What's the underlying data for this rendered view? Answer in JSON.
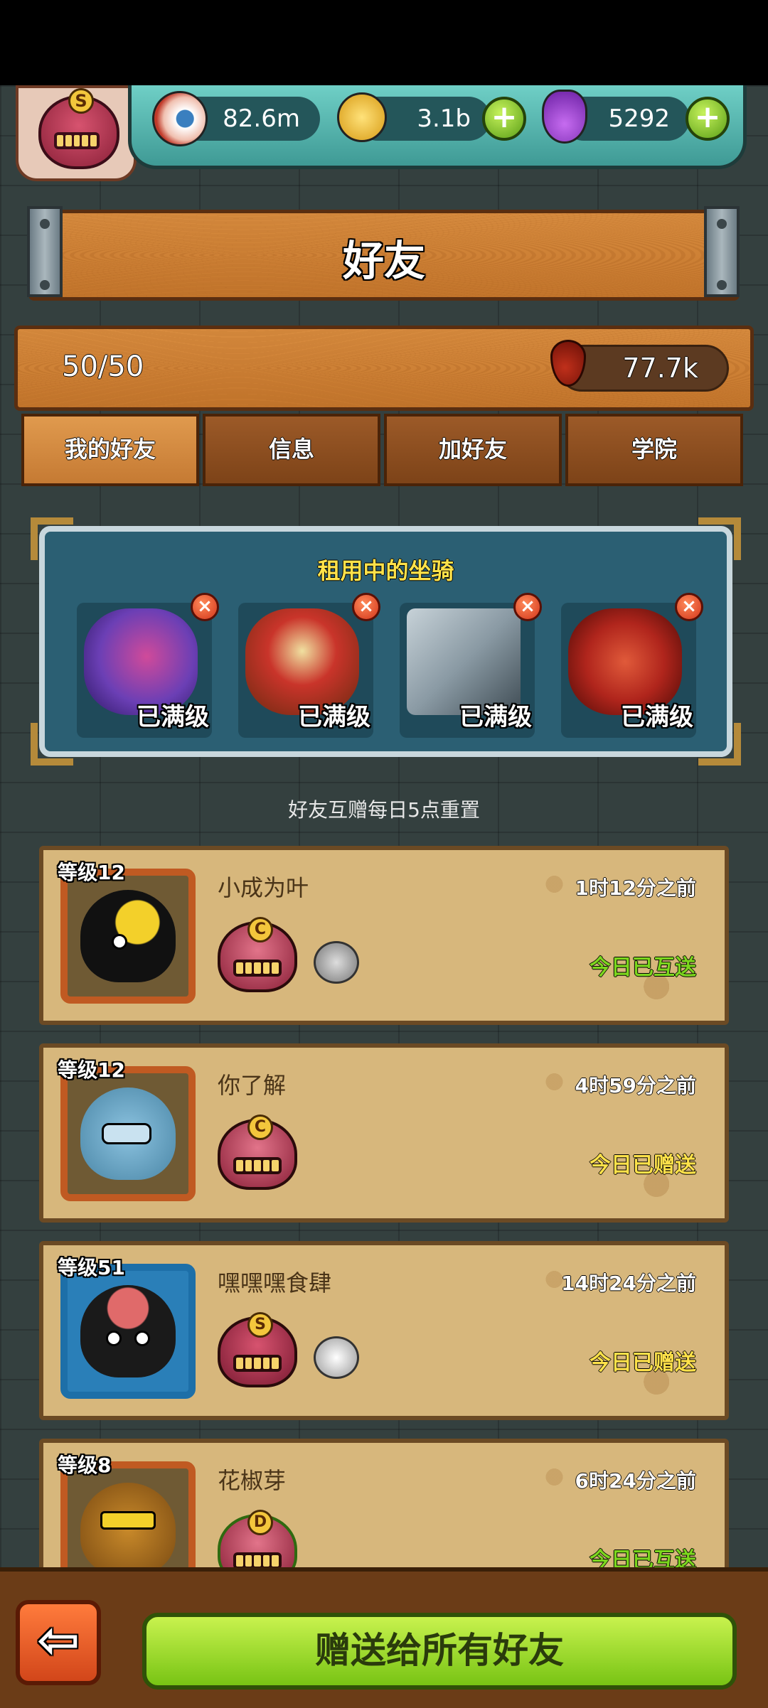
{
  "resources": {
    "eyes": "82.6m",
    "coins": "3.1b",
    "potions": "5292",
    "rank_badge": "S",
    "plus_label": "+"
  },
  "page_title": "好友",
  "friend_count": "50/50",
  "blood": "77.7k",
  "tabs": [
    {
      "label": "我的好友",
      "active": true
    },
    {
      "label": "信息",
      "active": false
    },
    {
      "label": "加好友",
      "active": false
    },
    {
      "label": "学院",
      "active": false
    }
  ],
  "rented_mounts": {
    "title": "租用中的坐骑",
    "close_label": "×",
    "items": [
      {
        "name": "rose-mount",
        "status": "已满级",
        "color": "#6b3fb5"
      },
      {
        "name": "lion-dance-mount",
        "status": "已满级",
        "color": "#c9342a"
      },
      {
        "name": "cannon-mount",
        "status": "已满级",
        "color": "#8a9aa4"
      },
      {
        "name": "demon-mount",
        "status": "已满级",
        "color": "#b0251c"
      }
    ]
  },
  "reset_note": "好友互赠每日5点重置",
  "friends": [
    {
      "level": "等级12",
      "name": "小成为叶",
      "time": "1时12分之前",
      "status": "今日已互送",
      "status_color": "#7cd61e",
      "grade": "C",
      "monster_color": "#d7536f",
      "has_mount": true
    },
    {
      "level": "等级12",
      "name": "你了解",
      "time": "4时59分之前",
      "status": "今日已赠送",
      "status_color": "#ffe24a",
      "grade": "C",
      "monster_color": "#d7536f",
      "has_mount": false
    },
    {
      "level": "等级51",
      "name": "嘿嘿嘿食肆",
      "time": "14时24分之前",
      "status": "今日已赠送",
      "status_color": "#ffe24a",
      "grade": "S",
      "monster_color": "#c2415e",
      "has_mount": true
    },
    {
      "level": "等级8",
      "name": "花椒芽",
      "time": "6时24分之前",
      "status": "今日已互送",
      "status_color": "#7cd61e",
      "grade": "D",
      "monster_color": "#d7536f",
      "has_mount": false
    }
  ],
  "back_label": "⇦",
  "gift_all_label": "赠送给所有好友"
}
